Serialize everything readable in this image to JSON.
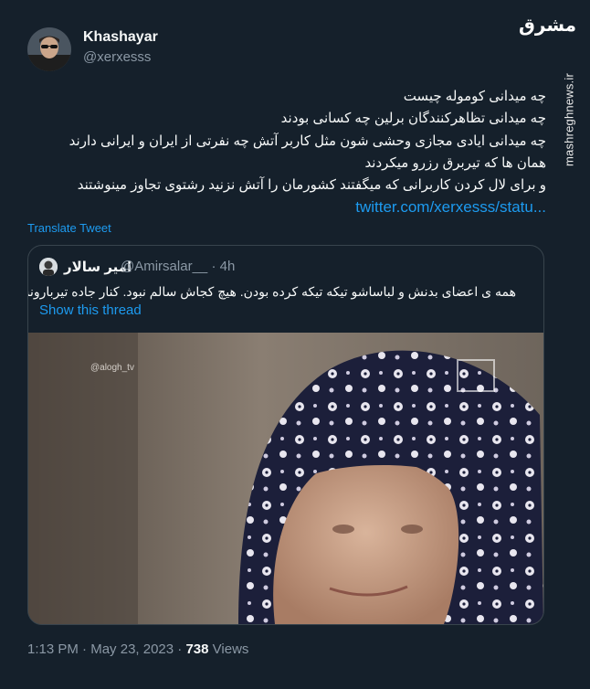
{
  "author": {
    "name": "Khashayar",
    "handle": "@xerxesss"
  },
  "watermark": {
    "logo": "مشرق",
    "site": "mashreghnews.ir"
  },
  "tweet": {
    "lines": [
      "چه میدانی کومولە چیست",
      "چه میدانی تظاهرکنندگان برلین چه کسانی بودند",
      "چه میدانی ایادی مجازی وحشی شون مثل کاربر آتش چه نفرتی از ایران و ایرانی دارند",
      "همان ها که تیربرق رزرو میکردند",
      "و برای لال کردن کاربرانی که میگفتند کشورمان را آتش نزنید رشتوی تجاوز مینوشتند"
    ],
    "link": "twitter.com/xerxesss/statu...",
    "translate_label": "Translate Tweet"
  },
  "quote": {
    "name": "امیر سالار",
    "handle": "@Amirsalar__",
    "separator": "·",
    "time": "4h",
    "text": "همه ی اعضای بدنش و لباساشو تیکه تیکه کرده بودن. هیچ کجاش سالم نبود. کنار جاده تیربارونشم کرده بودن!",
    "show_thread": "Show this thread",
    "media_watermark": "@alogh_tv"
  },
  "footer": {
    "time": "1:13 PM",
    "dot": "·",
    "date": "May 23, 2023",
    "dot2": "·",
    "views_count": "738",
    "views_label": "Views"
  },
  "colors": {
    "background": "#15202b",
    "accent": "#1d9bf0",
    "secondary_text": "#8b98a5",
    "border": "#38444d"
  }
}
